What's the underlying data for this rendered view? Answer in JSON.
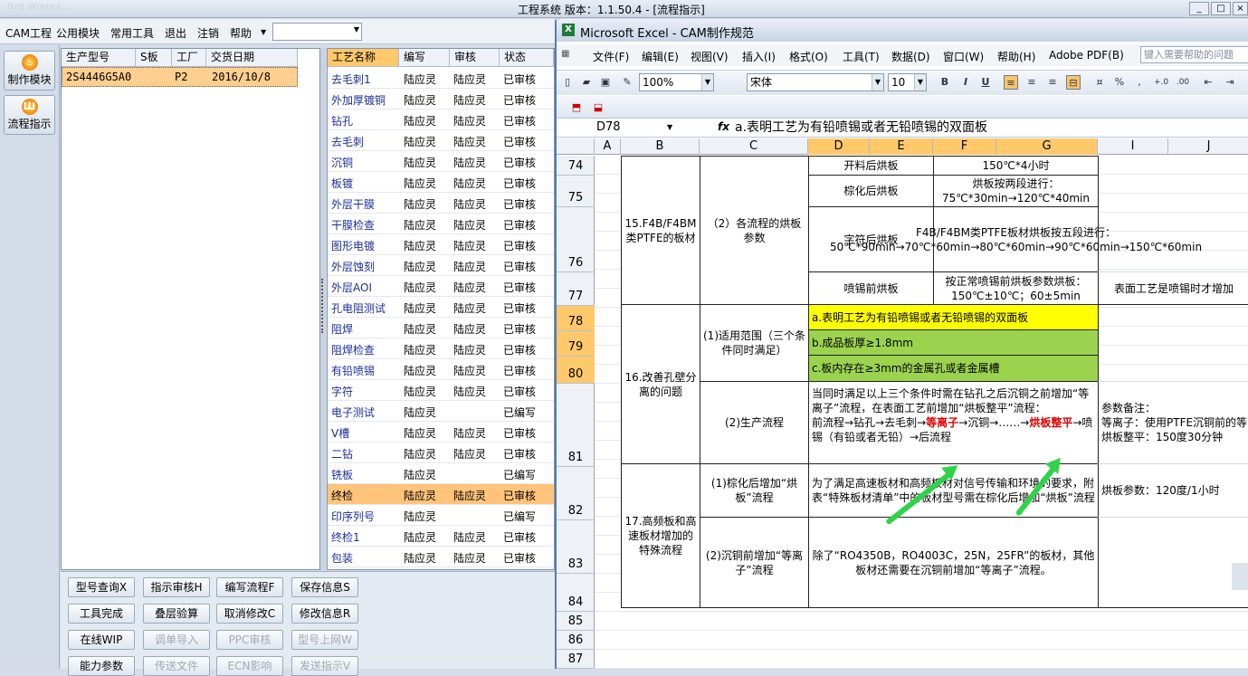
{
  "app": {
    "title": "工程系统  版本：1.1.50.4 - [流程指示]",
    "blurred_tabs": "Ord Wintes..."
  },
  "menu": {
    "items": [
      "CAM工程",
      "公用模块",
      "常用工具",
      "退出",
      "注销",
      "帮助"
    ],
    "combo_value": ""
  },
  "nav": {
    "items": [
      {
        "label": "制作模块"
      },
      {
        "label": "流程指示"
      }
    ]
  },
  "grid1": {
    "headers": [
      "生产型号",
      "S板",
      "工厂",
      "交货日期"
    ],
    "rows": [
      [
        "2S4446G5A0",
        "",
        "P2",
        "2016/10/8"
      ]
    ]
  },
  "grid2": {
    "headers": [
      "工艺名称",
      "编写",
      "审核",
      "状态"
    ],
    "rows": [
      [
        "去毛刺1",
        "陆应灵",
        "陆应灵",
        "已审核"
      ],
      [
        "外加厚镀铜",
        "陆应灵",
        "陆应灵",
        "已审核"
      ],
      [
        "钻孔",
        "陆应灵",
        "陆应灵",
        "已审核"
      ],
      [
        "去毛刺",
        "陆应灵",
        "陆应灵",
        "已审核"
      ],
      [
        "沉铜",
        "陆应灵",
        "陆应灵",
        "已审核"
      ],
      [
        "板镀",
        "陆应灵",
        "陆应灵",
        "已审核"
      ],
      [
        "外层干膜",
        "陆应灵",
        "陆应灵",
        "已审核"
      ],
      [
        "干膜检查",
        "陆应灵",
        "陆应灵",
        "已审核"
      ],
      [
        "图形电镀",
        "陆应灵",
        "陆应灵",
        "已审核"
      ],
      [
        "外层蚀刻",
        "陆应灵",
        "陆应灵",
        "已审核"
      ],
      [
        "外层AOI",
        "陆应灵",
        "陆应灵",
        "已审核"
      ],
      [
        "孔电阻测试",
        "陆应灵",
        "陆应灵",
        "已审核"
      ],
      [
        "阻焊",
        "陆应灵",
        "陆应灵",
        "已审核"
      ],
      [
        "阻焊检查",
        "陆应灵",
        "陆应灵",
        "已审核"
      ],
      [
        "有铅喷锡",
        "陆应灵",
        "陆应灵",
        "已审核"
      ],
      [
        "字符",
        "陆应灵",
        "陆应灵",
        "已审核"
      ],
      [
        "电子测试",
        "陆应灵",
        "",
        "已编写"
      ],
      [
        "V槽",
        "陆应灵",
        "陆应灵",
        "已审核"
      ],
      [
        "二钻",
        "陆应灵",
        "陆应灵",
        "已审核"
      ],
      [
        "铣板",
        "陆应灵",
        "",
        "已编写"
      ],
      [
        "终检",
        "陆应灵",
        "陆应灵",
        "已审核"
      ],
      [
        "印序列号",
        "陆应灵",
        "",
        "已编写"
      ],
      [
        "终检1",
        "陆应灵",
        "陆应灵",
        "已审核"
      ],
      [
        "包装",
        "陆应灵",
        "陆应灵",
        "已审核"
      ]
    ],
    "highlight_row": 20
  },
  "buttons": [
    [
      {
        "label": "型号查询X",
        "enabled": true
      },
      {
        "label": "指示审核H",
        "enabled": true
      },
      {
        "label": "编写流程F",
        "enabled": true
      },
      {
        "label": "保存信息S",
        "enabled": true
      }
    ],
    [
      {
        "label": "工具完成",
        "enabled": true
      },
      {
        "label": "叠层验算",
        "enabled": true
      },
      {
        "label": "取消修改C",
        "enabled": true
      },
      {
        "label": "修改信息R",
        "enabled": true
      }
    ],
    [
      {
        "label": "在线WIP",
        "enabled": true
      },
      {
        "label": "调单导入",
        "enabled": false
      },
      {
        "label": "PPC审核",
        "enabled": false
      },
      {
        "label": "型号上网W",
        "enabled": false
      }
    ],
    [
      {
        "label": "能力参数",
        "enabled": true
      },
      {
        "label": "传送文件",
        "enabled": false
      },
      {
        "label": "ECN影响",
        "enabled": false
      },
      {
        "label": "发送指示V",
        "enabled": false
      }
    ]
  ],
  "excel": {
    "title": "Microsoft Excel - CAM制作规范",
    "menu": [
      "文件(F)",
      "编辑(E)",
      "视图(V)",
      "插入(I)",
      "格式(O)",
      "工具(T)",
      "数据(D)",
      "窗口(W)",
      "帮助(H)",
      "Adobe PDF(B)"
    ],
    "help_placeholder": "键入需要帮助的问题",
    "zoom": "100%",
    "font": "宋体",
    "size": "10",
    "cell_ref": "D78",
    "formula": "a.表明工艺为有铅喷锡或者无铅喷锡的双面板",
    "columns": [
      "A",
      "B",
      "C",
      "D",
      "E",
      "F",
      "G",
      "I",
      "J"
    ],
    "rows": [
      "74",
      "75",
      "76",
      "77",
      "78",
      "79",
      "80",
      "81",
      "82",
      "83",
      "84",
      "85",
      "86",
      "87"
    ],
    "cells": {
      "b15": "15.F4B/F4BM类PTFE的板材",
      "c15": "（2）各流程的烘板参数",
      "d74": "开料后烘板",
      "f74": "150℃*4小时",
      "d75": "棕化后烘板",
      "f75": "烘板按两段进行：75℃*30min→120℃*40min",
      "d76": "字符后烘板",
      "f76": "F4B/F4BM类PTFE板材烘板按五段进行：50℃*90min→70℃*60min→80℃*60min→90℃*60min→150℃*60min",
      "d77": "喷锡前烘板",
      "f77": "按正常喷锡前烘板参数烘板：150℃±10℃；60±5min",
      "i77": "表面工艺是喷锡时才增加",
      "b16": "16.改善孔壁分离的问题",
      "c16a": "(1)适用范围（三个条件同时满足）",
      "d78": "a.表明工艺为有铅喷锡或者无铅喷锡的双面板",
      "d79": "b.成品板厚≥1.8mm",
      "d80": "c.板内存在≥3mm的金属孔或者金属槽",
      "c81": "(2)生产流程",
      "d81_1": "当同时满足以上三个条件时需在钻孔之后沉铜之前增加“等离子”流程，在表面工艺前增加“烘板整平”流程：",
      "d81_2": "前流程→钻孔→去毛刺→",
      "d81_red1": "等离子",
      "d81_3": "→沉铜→……→",
      "d81_red2": "烘板整平",
      "d81_4": "→喷锡（有铅或者无铅）→后流程",
      "i81": "参数备注：\n等离子：使用PTFE沉铜前的等\n烘板整平：150度30分钟",
      "b17": "17.高频板和高速板材增加的特殊流程",
      "c82": "(1)棕化后增加“烘板”流程",
      "d82": "为了满足高速板材和高频板材对信号传输和环境的要求，附表“特殊板材清单”中的板材型号需在棕化后增加“烘板”流程",
      "i82": "烘板参数：120度/1小时",
      "c83": "(2)沉铜前增加“等离子”流程",
      "d83": "除了“RO4350B，RO4003C，25N，25FR”的板材，其他板材还需要在沉铜前增加“等离子”流程。"
    }
  },
  "colors": {
    "accent": "#ffc96b",
    "highlight_yellow": "#ffff00",
    "highlight_green": "#9bd34f",
    "arrow": "#2fd34a",
    "red": "#e00000"
  }
}
